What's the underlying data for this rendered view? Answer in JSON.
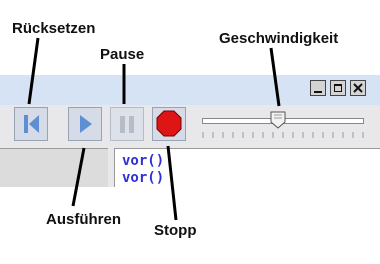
{
  "labels": {
    "reset": "Rücksetzen",
    "pause": "Pause",
    "speed": "Geschwindigkeit",
    "run": "Ausführen",
    "stop": "Stopp"
  },
  "window_controls": [
    "minimize",
    "maximize",
    "close"
  ],
  "toolbar": {
    "buttons": [
      {
        "name": "reset",
        "icon": "skip-back-icon"
      },
      {
        "name": "run",
        "icon": "play-icon"
      },
      {
        "name": "pause",
        "icon": "pause-icon"
      },
      {
        "name": "stop",
        "icon": "stop-octagon-icon"
      }
    ],
    "speed_slider_value": 0.47
  },
  "editor": {
    "lines": [
      "vor()",
      "vor()"
    ]
  },
  "colors": {
    "icon_blue": "#5e8fd3",
    "stop_red": "#dd1515",
    "code_blue": "#2f2fd6",
    "titlebar": "#d6e3f5",
    "toolbar": "#e8e8ea"
  }
}
